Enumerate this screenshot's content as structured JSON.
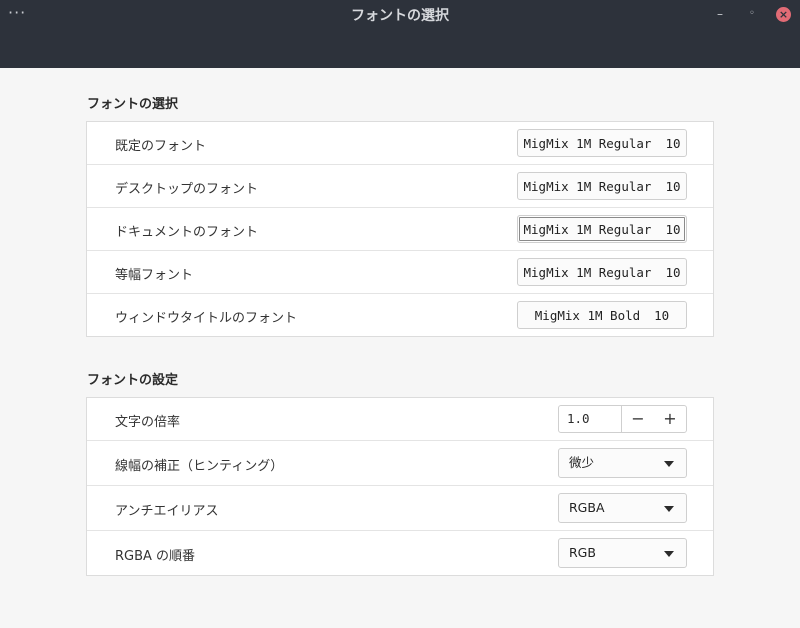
{
  "window": {
    "title": "フォントの選択",
    "menu_glyph": "···",
    "minimize_glyph": "–",
    "maximize_glyph": "◦",
    "close_glyph": "×"
  },
  "fonts_section": {
    "title": "フォントの選択",
    "rows": [
      {
        "label": "既定のフォント",
        "font": "MigMix 1M Regular",
        "size": "10"
      },
      {
        "label": "デスクトップのフォント",
        "font": "MigMix 1M Regular",
        "size": "10"
      },
      {
        "label": "ドキュメントのフォント",
        "font": "MigMix 1M Regular",
        "size": "10"
      },
      {
        "label": "等幅フォント",
        "font": "MigMix 1M Regular",
        "size": "10"
      },
      {
        "label": "ウィンドウタイトルのフォント",
        "font": "MigMix 1M Bold",
        "size": "10"
      }
    ]
  },
  "settings_section": {
    "title": "フォントの設定",
    "scaling": {
      "label": "文字の倍率",
      "value": "1.0",
      "minus": "−",
      "plus": "+"
    },
    "hinting": {
      "label": "線幅の補正（ヒンティング）",
      "value": "微少"
    },
    "antialiasing": {
      "label": "アンチエイリアス",
      "value": "RGBA"
    },
    "rgba_order": {
      "label": "RGBA の順番",
      "value": "RGB"
    }
  }
}
